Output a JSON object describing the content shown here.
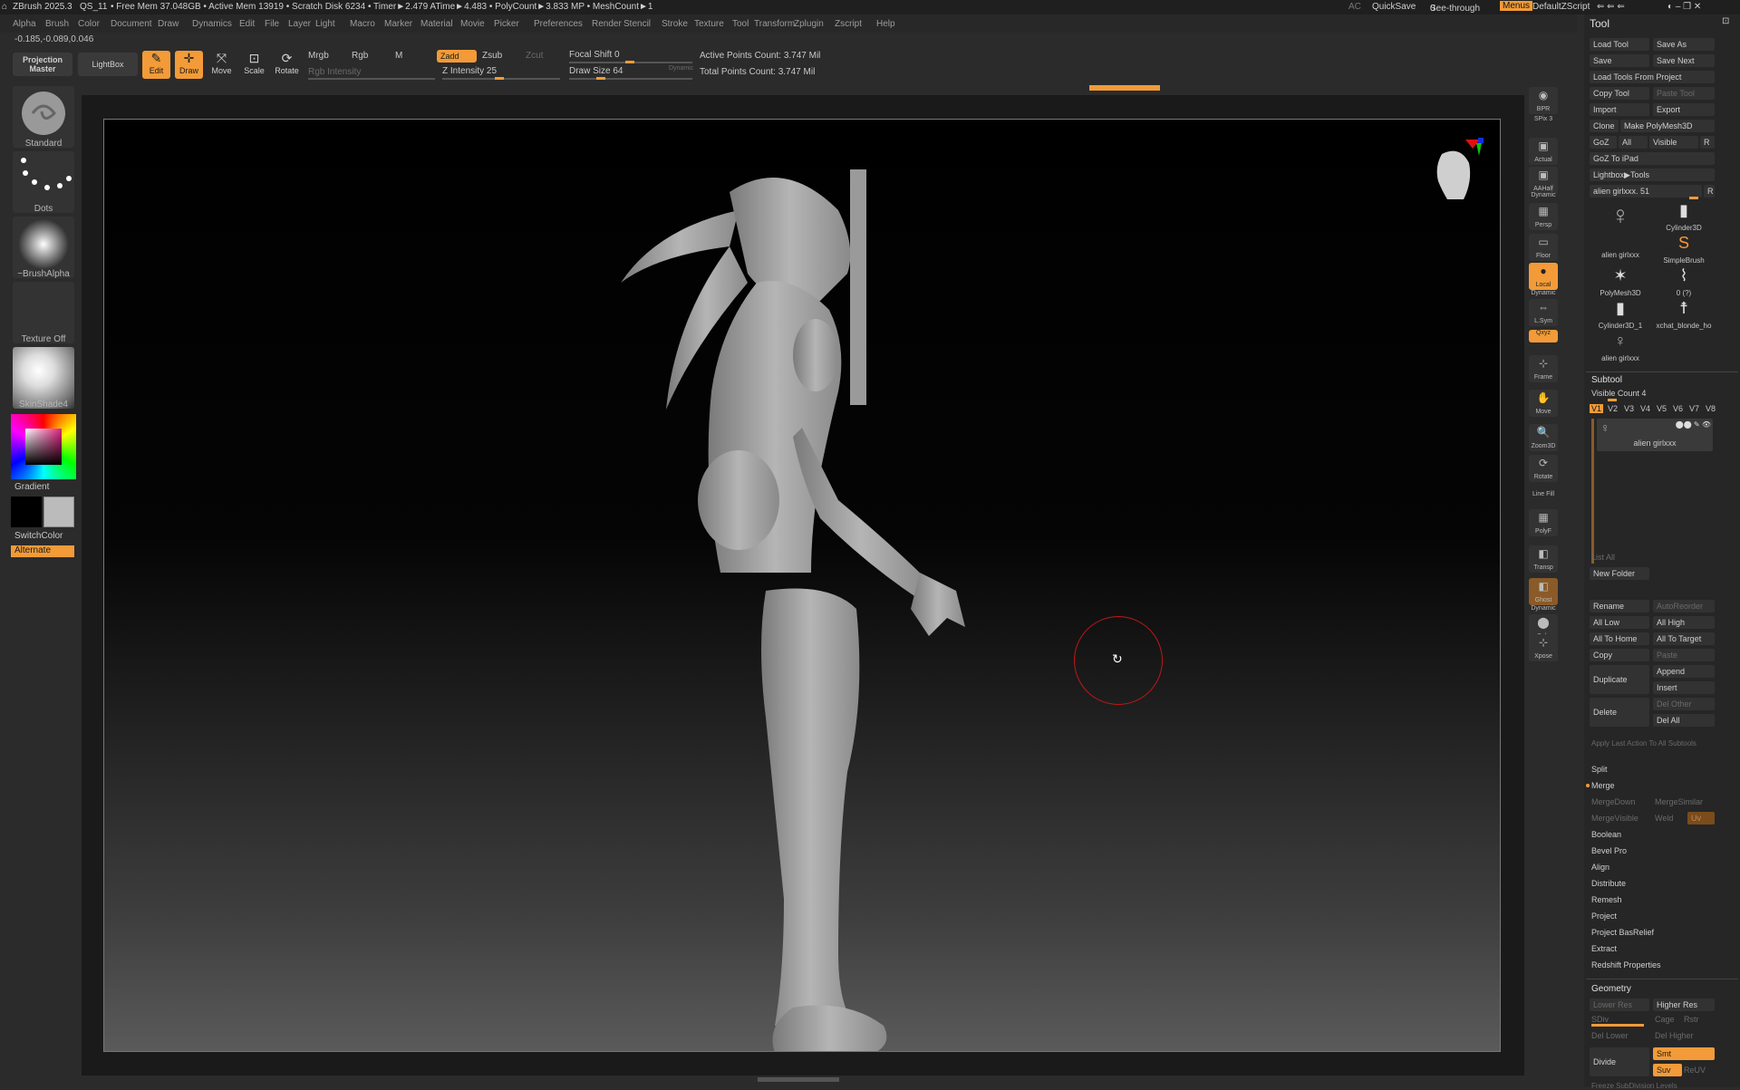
{
  "titlebar": {
    "app": "ZBrush 2025.3",
    "script": "QS_11",
    "stats": "• Free Mem 37.048GB • Active Mem 13919 • Scratch Disk 6234 • Timer►2.479 ATime►4.483 • PolyCount►3.833 MP • MeshCount►1",
    "ac": "AC",
    "quicksave": "QuickSave",
    "seethrough": "See-through",
    "seethrough_value": "0",
    "menus": "Menus",
    "default_zscript": "DefaultZScript"
  },
  "menubar": [
    "Alpha",
    "Brush",
    "Color",
    "Document",
    "Draw",
    "Dynamics",
    "Edit",
    "File",
    "Layer",
    "Light",
    "Macro",
    "Marker",
    "Material",
    "Movie",
    "Picker",
    "Preferences",
    "Render",
    "Stencil",
    "Stroke",
    "Texture",
    "Tool",
    "Transform",
    "Zplugin",
    "Zscript",
    "Help"
  ],
  "coords": "-0.185,-0.089,0.046",
  "toolbar": {
    "projection_master": "Projection Master",
    "lightbox": "LightBox",
    "edit": "Edit",
    "draw": "Draw",
    "move": "Move",
    "scale": "Scale",
    "rotate": "Rotate",
    "mrgb": "Mrgb",
    "rgb": "Rgb",
    "m": "M",
    "rgb_intensity": "Rgb Intensity",
    "zadd": "Zadd",
    "zsub": "Zsub",
    "zcut": "Zcut",
    "z_intensity_label": "Z Intensity",
    "z_intensity_value": "25",
    "focal_shift_label": "Focal Shift",
    "focal_shift_value": "0",
    "draw_size_label": "Draw Size",
    "draw_size_value": "64",
    "dynamic": "Dynamic",
    "active_points": "Active Points Count: 3.747 Mil",
    "total_points": "Total Points Count: 3.747 Mil"
  },
  "leftshelf": {
    "brush": "Standard",
    "stroke": "Dots",
    "alpha": "~BrushAlpha",
    "texture": "Texture Off",
    "material": "SkinShade4",
    "gradient": "Gradient",
    "switchcolor": "SwitchColor",
    "alternate": "Alternate"
  },
  "rightshelf": [
    "BPR",
    "SPix 3",
    "Actual",
    "AAHalf",
    "Dynamic",
    "Persp",
    "Floor",
    "Local",
    "Dynamic",
    "L.Sym",
    "Qxyz",
    "Frame",
    "Move",
    "Zoom3D",
    "Rotate",
    "Line Fill",
    "PolyF",
    "Transp",
    "Ghost",
    "Dynamic",
    "Solo",
    "Xpose"
  ],
  "toolpanel": {
    "title": "Tool",
    "buttons": {
      "load_tool": "Load Tool",
      "save_as": "Save As",
      "save": "Save",
      "save_next": "Save Next",
      "load_from_project": "Load Tools From Project",
      "copy_tool": "Copy Tool",
      "paste_tool": "Paste Tool",
      "import": "Import",
      "export": "Export",
      "clone": "Clone",
      "make_polymesh": "Make PolyMesh3D",
      "goz": "GoZ",
      "all": "All",
      "visible": "Visible",
      "r": "R",
      "goz_ipad": "GoZ To iPad",
      "lightbox_tools": "Lightbox▶Tools",
      "current_tool": "alien girlxxx. 51"
    },
    "tools": [
      "alien girlxxx",
      "Cylinder3D",
      "SimpleBrush",
      "PolyMesh3D",
      "0 (?)",
      "Cylinder3D_1",
      "xchat_blonde_ho",
      "alien girlxxx"
    ],
    "subtool": {
      "header": "Subtool",
      "visible_count": "Visible Count 4",
      "versions": [
        "V1",
        "V2",
        "V3",
        "V4",
        "V5",
        "V6",
        "V7",
        "V8"
      ],
      "item_name": "alien girlxxx",
      "list_all": "List All",
      "new_folder": "New Folder",
      "rename": "Rename",
      "autoreorder": "AutoReorder",
      "all_low": "All Low",
      "all_high": "All High",
      "all_to_home": "All To Home",
      "all_to_target": "All To Target",
      "copy": "Copy",
      "paste": "Paste",
      "duplicate": "Duplicate",
      "append": "Append",
      "insert": "Insert",
      "delete": "Delete",
      "del_other": "Del Other",
      "del_all": "Del All",
      "apply_last": "Apply Last Action To All Subtools",
      "sections": [
        "Split",
        "Merge"
      ],
      "merge_down": "MergeDown",
      "merge_similar": "MergeSimilar",
      "merge_visible": "MergeVisible",
      "weld": "Weld",
      "uv": "Uv",
      "more_sections": [
        "Boolean",
        "Bevel Pro",
        "Align",
        "Distribute",
        "Remesh",
        "Project",
        "Project BasRelief",
        "Extract",
        "Redshift Properties"
      ]
    },
    "geometry": {
      "header": "Geometry",
      "lower_res": "Lower Res",
      "higher_res": "Higher Res",
      "sdiv": "SDiv",
      "cage": "Cage",
      "rstr": "Rstr",
      "del_lower": "Del Lower",
      "del_higher": "Del Higher",
      "divide": "Divide",
      "smt": "Smt",
      "suv": "Suv",
      "reuv": "ReUV",
      "freeze": "Freeze SubDivision Levels"
    }
  },
  "colors": {
    "accent": "#f29b38",
    "panel": "#262626",
    "button": "#323232"
  }
}
